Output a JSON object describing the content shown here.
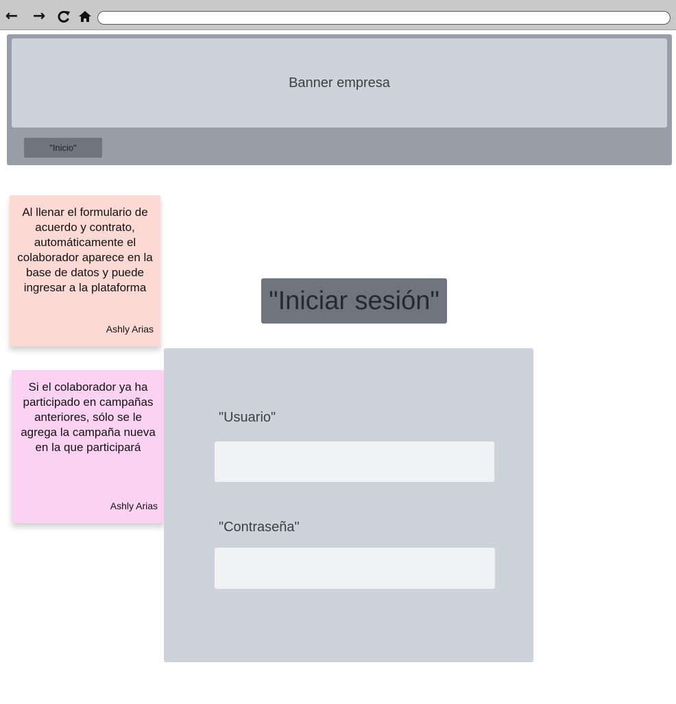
{
  "browser": {
    "back_icon": "arrow-left-icon",
    "forward_icon": "arrow-right-icon",
    "reload_icon": "reload-icon",
    "home_icon": "home-icon",
    "address": ""
  },
  "header": {
    "banner_text": "Banner empresa",
    "nav_tab_label": "\"Inicio\""
  },
  "notes": [
    {
      "text": "Al llenar el formulario de acuerdo y contrato, automáticamente el colaborador aparece en la base de datos y puede ingresar a la plataforma",
      "author": "Ashly Arias",
      "color": "#fdd9d5"
    },
    {
      "text": "Si el colaborador ya ha participado en campañas anteriores, sólo se le agrega la campaña nueva en la que participará",
      "author": "Ashly Arias",
      "color": "#fcd2f2"
    }
  ],
  "login": {
    "title": "\"Iniciar sesión\"",
    "username_label": "\"Usuario\"",
    "username_value": "",
    "password_label": "\"Contraseña\"",
    "password_value": ""
  },
  "colors": {
    "header_bg": "#979ea8",
    "banner_bg": "#cdd3db",
    "title_bg": "#6f747f",
    "panel_bg": "#cdd3db",
    "input_bg": "#f1f2f4"
  }
}
